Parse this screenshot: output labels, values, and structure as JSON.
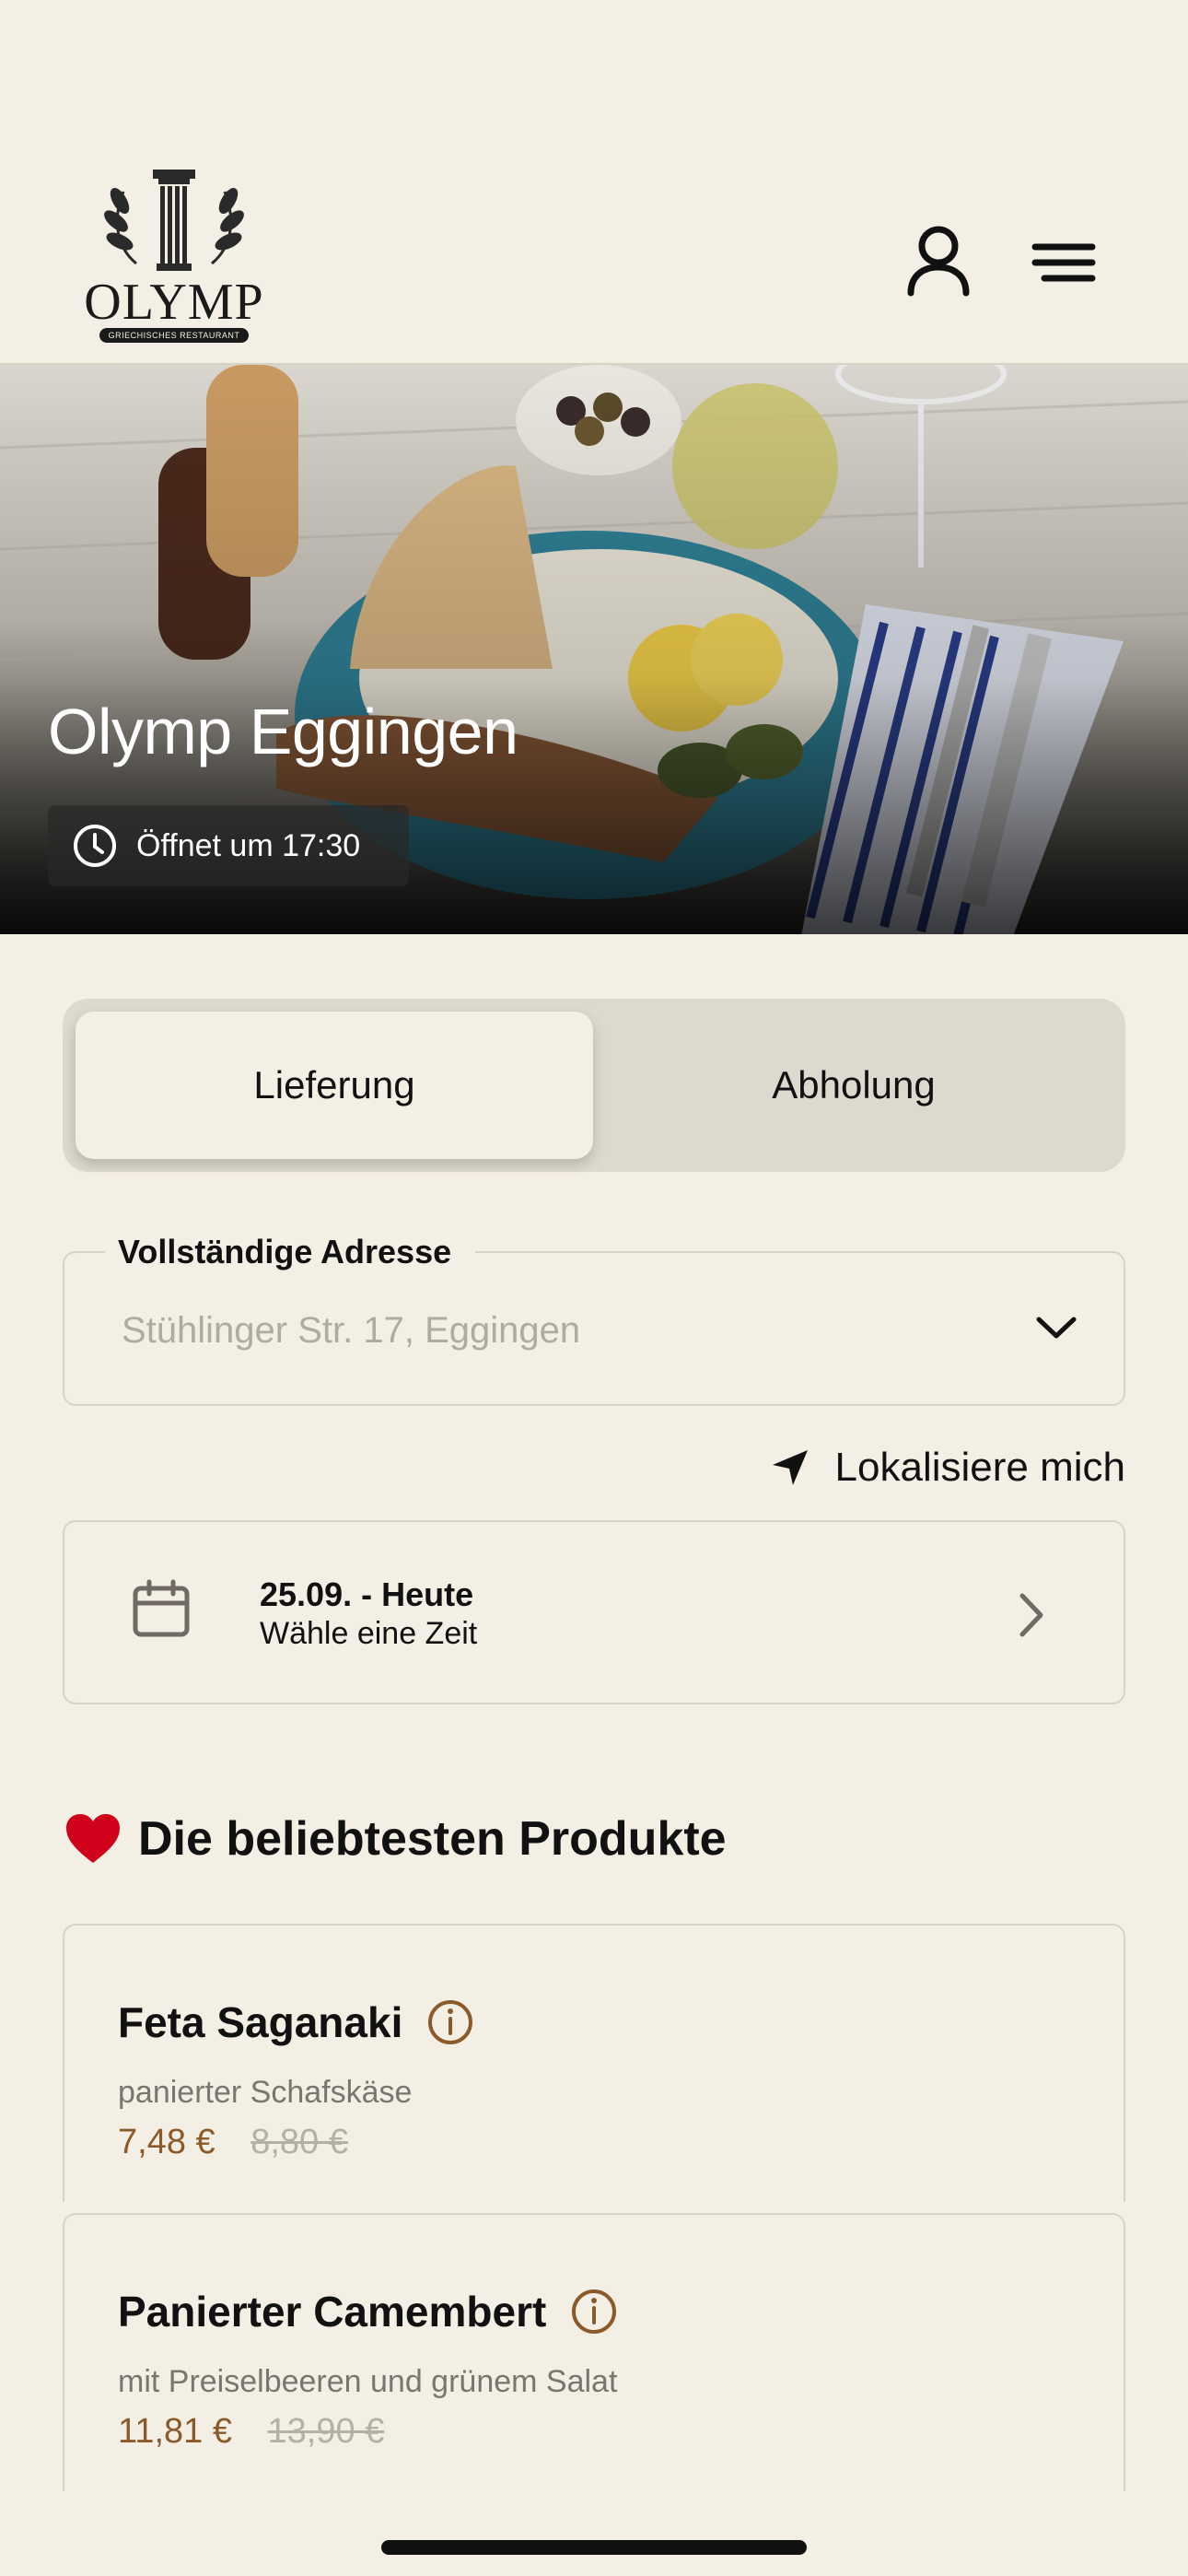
{
  "header": {
    "logo_word": "OLYMP",
    "logo_sub": "GRIECHISCHES RESTAURANT",
    "profile_icon": "user-icon",
    "menu_icon": "hamburger-menu-icon"
  },
  "hero": {
    "title": "Olymp Eggingen",
    "status_icon": "clock-icon",
    "status": "Öffnet um 17:30"
  },
  "order_type": {
    "options": [
      "Lieferung",
      "Abholung"
    ],
    "selected": "Lieferung"
  },
  "address": {
    "label": "Vollständige Adresse",
    "placeholder": "Stühlinger Str. 17, Eggingen",
    "chevron_icon": "chevron-down-icon"
  },
  "locate": {
    "icon": "location-arrow-icon",
    "label": "Lokalisiere mich"
  },
  "date": {
    "icon": "calendar-icon",
    "title": "25.09. - Heute",
    "subtitle": "Wähle eine Zeit",
    "chevron_icon": "chevron-right-icon"
  },
  "popular": {
    "icon": "heart-icon",
    "title": "Die beliebtesten Produkte",
    "items": [
      {
        "name": "Feta Saganaki",
        "description": "panierter Schafskäse",
        "price": "7,48 €",
        "old_price": "8,80 €"
      },
      {
        "name": "Panierter Camembert",
        "description": "mit Preiselbeeren und grünem Salat",
        "price": "11,81 €",
        "old_price": "13,90 €"
      }
    ]
  },
  "colors": {
    "background": "#f4efe4",
    "accent_price": "#8a5a2b",
    "heart": "#d0021b",
    "segment_track": "#ddd9ce"
  }
}
